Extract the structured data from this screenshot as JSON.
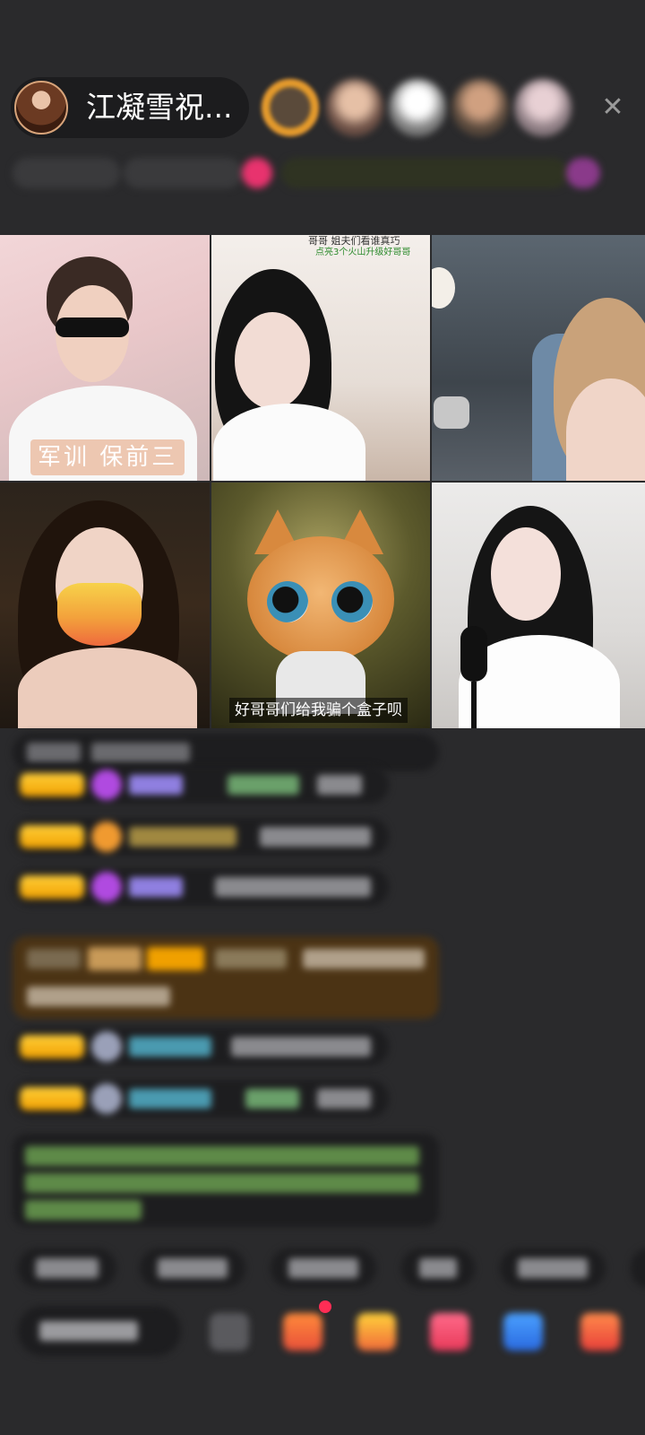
{
  "header": {
    "host_name": "江凝雪祝...",
    "close_label": "✕"
  },
  "video_grid": {
    "tile1_caption": "军训  保前三",
    "tile2_banner_line1": "哥哥  姐夫们看谁真巧",
    "tile2_banner_line2": "点亮3个火山升级好哥哥",
    "tile5_subtitle": "好哥哥们给我骗个盒子呗"
  },
  "icons": {
    "close": "close-icon",
    "gift": "gift-icon",
    "emoji": "emoji-icon"
  },
  "colors": {
    "background": "#2a2a2c",
    "badge_yellow": "#f0a000",
    "highlight_bg": "#4b3314",
    "accent_pink": "#ff2d55"
  }
}
